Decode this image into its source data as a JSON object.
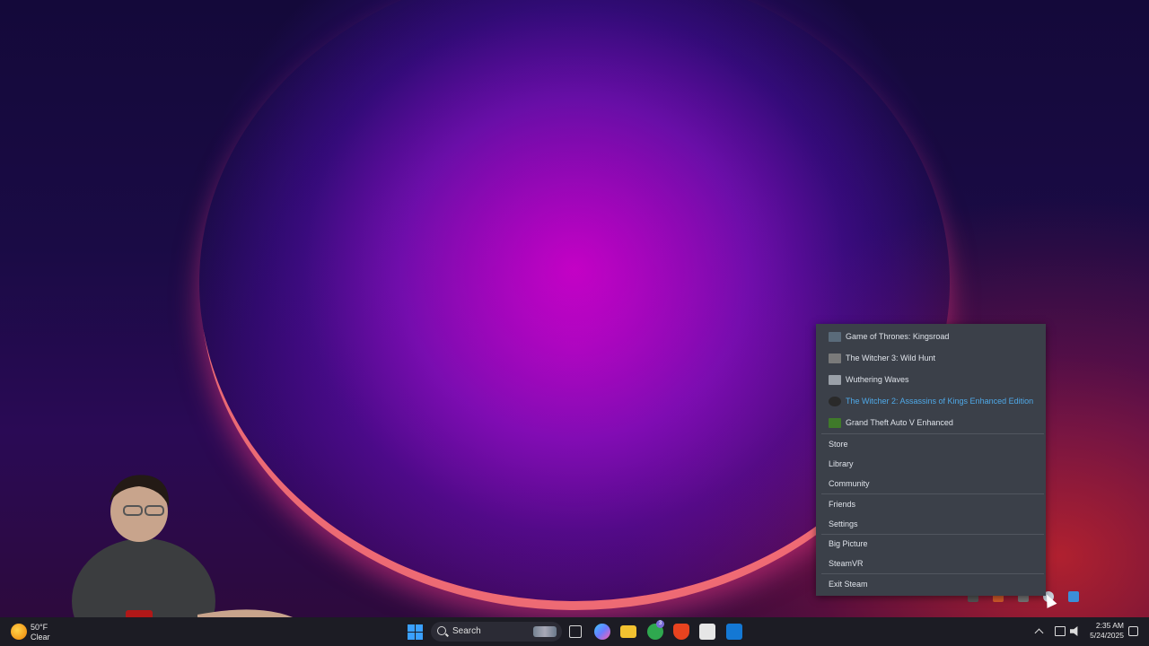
{
  "steam_menu": {
    "recent_games": [
      {
        "label": "Game of Thrones: Kingsroad",
        "icon": "kingsroad-icon",
        "color": "#5a6b7a"
      },
      {
        "label": "The Witcher 3: Wild Hunt",
        "icon": "witcher3-icon",
        "color": "#7a7a7a"
      },
      {
        "label": "Wuthering Waves",
        "icon": "wuthering-waves-icon",
        "color": "#9aa0a8"
      },
      {
        "label": "The Witcher 2: Assassins of Kings Enhanced Edition",
        "icon": "witcher2-icon",
        "color": "#2a2a2a"
      },
      {
        "label": "Grand Theft Auto V Enhanced",
        "icon": "gta5-icon",
        "color": "#3f7a2a"
      }
    ],
    "items": {
      "store": "Store",
      "library": "Library",
      "community": "Community",
      "friends": "Friends",
      "settings": "Settings",
      "big_picture": "Big Picture",
      "steamvr": "SteamVR",
      "exit": "Exit Steam"
    },
    "highlight_color": "#4fa9e8",
    "background_color": "#3b4049"
  },
  "taskbar": {
    "weather": {
      "temp": "50°F",
      "condition": "Clear"
    },
    "search_label": "Search",
    "apps": [
      {
        "name": "task-view-icon",
        "color": "#d8d8d8"
      },
      {
        "name": "copilot-icon",
        "color": "#6a7cff"
      },
      {
        "name": "file-explorer-icon",
        "color": "#f2c230"
      },
      {
        "name": "xbox-icon",
        "color": "#2fa84f",
        "badge": "3"
      },
      {
        "name": "brave-icon",
        "color": "#e8431f"
      },
      {
        "name": "microsoft-store-icon",
        "color": "#e6e6e6"
      },
      {
        "name": "outlook-icon",
        "color": "#1478d4"
      }
    ],
    "clock": {
      "time": "2:35 AM",
      "date": "5/24/2025"
    }
  }
}
